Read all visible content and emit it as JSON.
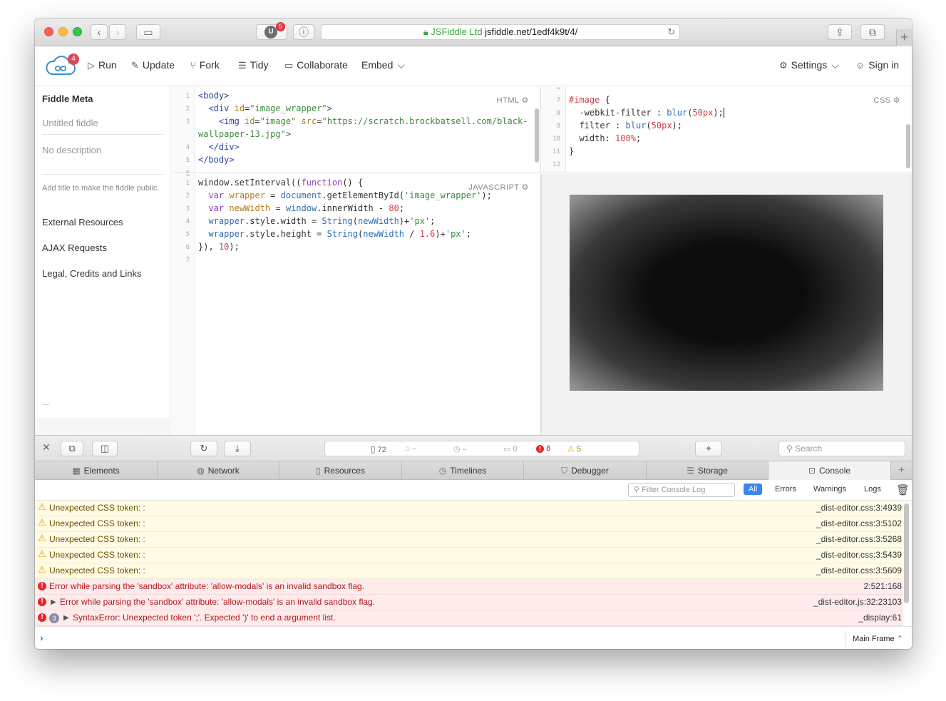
{
  "browser": {
    "ublock_count": "5",
    "ublock_letter": "U",
    "ev_label": "JSFiddle Ltd",
    "url": "jsfiddle.net/1edf4k9t/4/"
  },
  "toolbar": {
    "logo_badge": "4",
    "run": "Run",
    "update": "Update",
    "fork": "Fork",
    "tidy": "Tidy",
    "collaborate": "Collaborate",
    "embed": "Embed",
    "settings": "Settings",
    "signin": "Sign in"
  },
  "sidebar": {
    "title": "Fiddle Meta",
    "title_placeholder": "Untitled fiddle",
    "desc_placeholder": "No description",
    "hint": "Add title to make the fiddle public.",
    "links": [
      "External Resources",
      "AJAX Requests",
      "Legal, Credits and Links"
    ]
  },
  "editors": {
    "html_label": "HTML",
    "css_label": "CSS",
    "js_label": "JAVASCRIPT"
  },
  "devtools": {
    "stats": {
      "resources": "72",
      "size": "–",
      "time": "–",
      "logs": "0",
      "errors": "8",
      "warnings": "5"
    },
    "search_placeholder": "Search",
    "tabs": [
      "Elements",
      "Network",
      "Resources",
      "Timelines",
      "Debugger",
      "Storage",
      "Console"
    ],
    "filter_placeholder": "Filter Console Log",
    "filters": [
      "All",
      "Errors",
      "Warnings",
      "Logs"
    ],
    "messages": [
      {
        "type": "warn",
        "text": "Unexpected CSS token: :",
        "source": "_dist-editor.css:3:4939"
      },
      {
        "type": "warn",
        "text": "Unexpected CSS token: :",
        "source": "_dist-editor.css:3:5102"
      },
      {
        "type": "warn",
        "text": "Unexpected CSS token: :",
        "source": "_dist-editor.css:3:5268"
      },
      {
        "type": "warn",
        "text": "Unexpected CSS token: :",
        "source": "_dist-editor.css:3:5439"
      },
      {
        "type": "warn",
        "text": "Unexpected CSS token: :",
        "source": "_dist-editor.css:3:5609"
      },
      {
        "type": "err",
        "text": "Error while parsing the 'sandbox' attribute: 'allow-modals' is an invalid sandbox flag.",
        "source": "2:521:168"
      },
      {
        "type": "err",
        "text": "Error while parsing the 'sandbox' attribute: 'allow-modals' is an invalid sandbox flag.",
        "source": "_dist-editor.js:32:23103"
      },
      {
        "type": "err",
        "count": "3",
        "text": "SyntaxError: Unexpected token ';'. Expected ')' to end a argument list.",
        "source": "_display:61"
      }
    ],
    "frame": "Main Frame"
  }
}
